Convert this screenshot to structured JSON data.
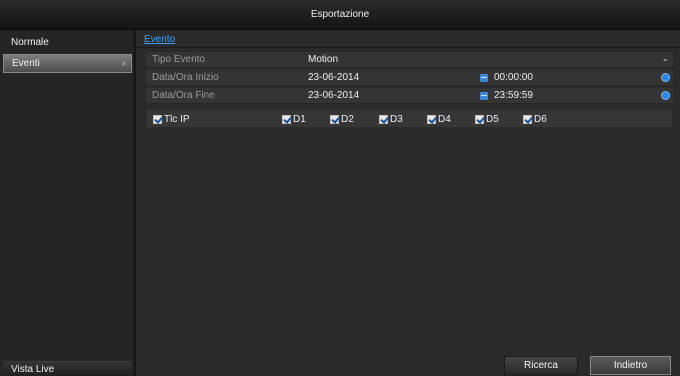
{
  "window": {
    "title": "Esportazione"
  },
  "sidebar": {
    "items": [
      {
        "label": "Normale"
      },
      {
        "label": "Eventi",
        "chevron": "›"
      }
    ],
    "live_label": "Vista Live"
  },
  "main": {
    "tab_label": "Evento",
    "fields": {
      "tipo_evento": {
        "label": "Tipo Evento",
        "value": "Motion"
      },
      "inizio": {
        "label": "Data/Ora Inizio",
        "date": "23-06-2014",
        "time": "00:00:00"
      },
      "fine": {
        "label": "Data/Ora Fine",
        "date": "23-06-2014",
        "time": "23:59:59"
      }
    },
    "cameras": [
      {
        "label": "Tlc IP",
        "checked": true
      },
      {
        "label": "D1",
        "checked": true
      },
      {
        "label": "D2",
        "checked": true
      },
      {
        "label": "D3",
        "checked": true
      },
      {
        "label": "D4",
        "checked": true
      },
      {
        "label": "D5",
        "checked": true
      },
      {
        "label": "D6",
        "checked": true
      }
    ],
    "buttons": {
      "search_label": "Ricerca",
      "back_label": "Indietro"
    }
  },
  "icons": {
    "calendar": "calendar-icon",
    "clock": "clock-icon",
    "dropdown": "chevron-down-icon"
  },
  "colors": {
    "accent": "#3aa3ff",
    "icon_blue": "#2f86e0"
  }
}
